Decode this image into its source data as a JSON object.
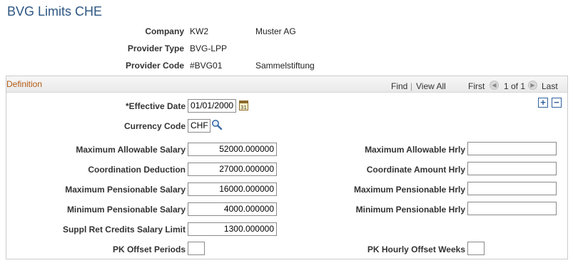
{
  "page": {
    "title": "BVG Limits CHE"
  },
  "header": {
    "company_label": "Company",
    "company_code": "KW2",
    "company_name": "Muster AG",
    "provider_type_label": "Provider Type",
    "provider_type_value": "BVG-LPP",
    "provider_code_label": "Provider Code",
    "provider_code_value": "#BVG01",
    "provider_code_name": "Sammelstiftung"
  },
  "definition": {
    "section_title": "Definition",
    "find": "Find",
    "view_all": "View All",
    "first": "First",
    "pager": "1 of 1",
    "last": "Last",
    "effective_date_label": "*Effective Date",
    "effective_date_value": "01/01/2000",
    "currency_code_label": "Currency Code",
    "currency_code_value": "CHF",
    "fields": {
      "max_allowable_salary": {
        "label": "Maximum Allowable Salary",
        "value": "52000.000000"
      },
      "coordination_deduction": {
        "label": "Coordination Deduction",
        "value": "27000.000000"
      },
      "max_pensionable_salary": {
        "label": "Maximum Pensionable Salary",
        "value": "16000.000000"
      },
      "min_pensionable_salary": {
        "label": "Minimum Pensionable Salary",
        "value": "4000.000000"
      },
      "suppl_ret_credits": {
        "label": "Suppl Ret Credits Salary Limit",
        "value": "1300.000000"
      },
      "pk_offset_periods": {
        "label": "PK Offset Periods",
        "value": ""
      },
      "max_allowable_hrly": {
        "label": "Maximum Allowable Hrly",
        "value": ""
      },
      "coordinate_amount_hrly": {
        "label": "Coordinate Amount Hrly",
        "value": ""
      },
      "max_pensionable_hrly": {
        "label": "Maximum Pensionable Hrly",
        "value": ""
      },
      "min_pensionable_hrly": {
        "label": "Minimum Pensionable Hrly",
        "value": ""
      },
      "pk_hourly_offset_weeks": {
        "label": "PK Hourly Offset Weeks",
        "value": ""
      }
    }
  },
  "icons": {
    "calendar": "calendar-icon",
    "lookup": "magnifier-icon",
    "add_row": "+",
    "delete_row": "−",
    "prev": "◀",
    "next": "▶"
  }
}
